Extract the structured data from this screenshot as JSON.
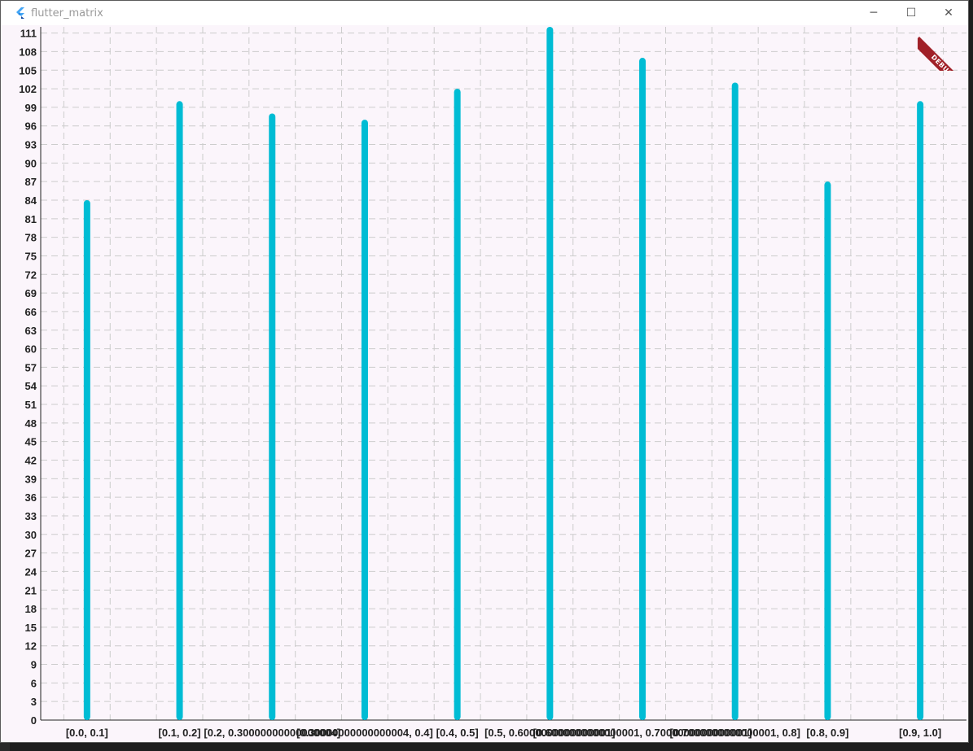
{
  "window": {
    "title": "flutter_matrix",
    "controls": {
      "minimize": "─",
      "maximize": "☐",
      "close": "✕"
    }
  },
  "debug_banner": "DEBUG",
  "colors": {
    "bar": "#00bcd4",
    "grid": "#cccccc",
    "background": "#fbf5fb",
    "axis": "#222222"
  },
  "chart_data": {
    "type": "bar",
    "categories": [
      "[0.0, 0.1]",
      "[0.1, 0.2]",
      "[0.2, 0.30000000000000004]",
      "[0.30000000000000004, 0.4]",
      "[0.4, 0.5]",
      "[0.5, 0.6000000000000001]",
      "[0.6000000000000001, 0.7000000000000001]",
      "[0.7000000000000001, 0.8]",
      "[0.8, 0.9]",
      "[0.9, 1.0]"
    ],
    "values": [
      84,
      100,
      98,
      97,
      102,
      112,
      107,
      103,
      87,
      100
    ],
    "ylim": [
      0,
      112
    ],
    "yticks": [
      0,
      3,
      6,
      9,
      12,
      15,
      18,
      21,
      24,
      27,
      30,
      33,
      36,
      39,
      42,
      45,
      48,
      51,
      54,
      57,
      60,
      63,
      66,
      69,
      72,
      75,
      78,
      81,
      84,
      87,
      90,
      93,
      96,
      99,
      102,
      105,
      108,
      111
    ],
    "grid": true,
    "xlabel": "",
    "ylabel": "",
    "title": ""
  }
}
